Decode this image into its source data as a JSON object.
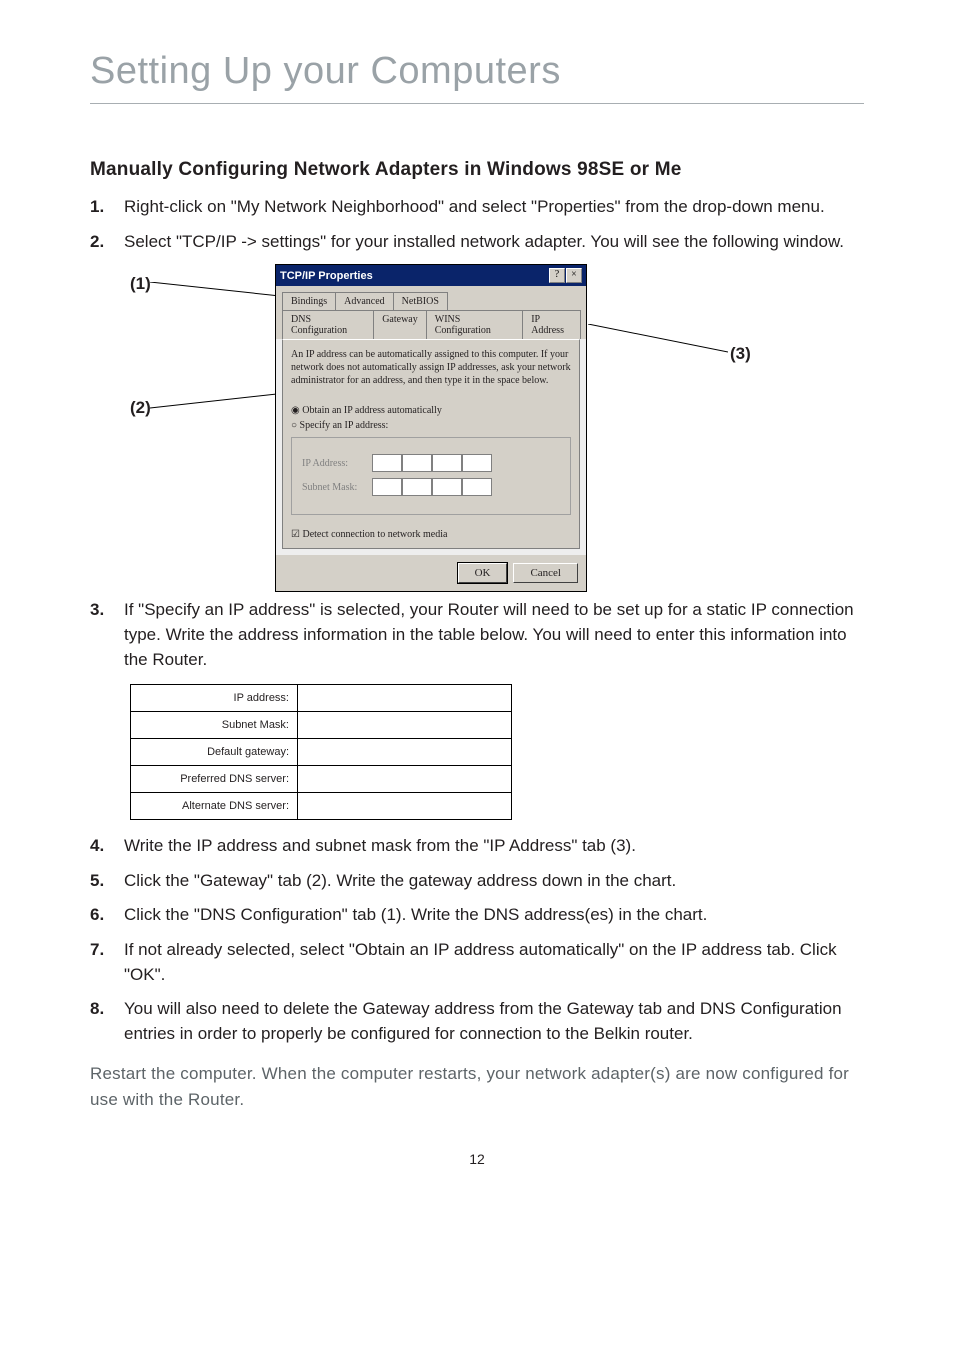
{
  "chapter_title": "Setting Up your Computers",
  "section_heading": "Manually Configuring Network Adapters in Windows 98SE or Me",
  "steps": {
    "s1": {
      "n": "1.",
      "t": "Right-click on \"My Network Neighborhood\" and select \"Properties\" from the drop-down menu."
    },
    "s2": {
      "n": "2.",
      "t": "Select \"TCP/IP -> settings\" for your installed network adapter. You will see the following window."
    },
    "s3": {
      "n": "3.",
      "t": "If \"Specify an IP address\" is selected, your Router will need to be set up for a static IP connection type. Write the address information in the table below. You will need to enter this information into the Router."
    },
    "s4": {
      "n": "4.",
      "t": "Write the IP address and subnet mask from the \"IP Address\" tab (3)."
    },
    "s5": {
      "n": "5.",
      "t": "Click the \"Gateway\" tab (2). Write the gateway address down in the chart."
    },
    "s6": {
      "n": "6.",
      "t": "Click the \"DNS Configuration\" tab (1). Write the DNS address(es) in the chart."
    },
    "s7": {
      "n": "7.",
      "t": "If not already selected, select \"Obtain an IP address automatically\" on the IP address tab. Click \"OK\"."
    },
    "s8": {
      "n": "8.",
      "t": "You will also need to delete the Gateway address from the Gateway tab and DNS Configuration entries in order to properly be configured for connection to the Belkin router."
    }
  },
  "callouts": {
    "c1": "(1)",
    "c2": "(2)",
    "c3": "(3)"
  },
  "win": {
    "title": "TCP/IP Properties",
    "help": "?",
    "close": "×",
    "tabs_row1": {
      "bindings": "Bindings",
      "advanced": "Advanced",
      "netbios": "NetBIOS"
    },
    "tabs_row2": {
      "dns": "DNS Configuration",
      "gateway": "Gateway",
      "wins": "WINS Configuration",
      "ip": "IP Address"
    },
    "desc": "An IP address can be automatically assigned to this computer. If your network does not automatically assign IP addresses, ask your network administrator for an address, and then type it in the space below.",
    "r_auto": "Obtain an IP address automatically",
    "r_spec": "Specify an IP address:",
    "ip_label": "IP Address:",
    "subnet_label": "Subnet Mask:",
    "detect": "Detect connection to network media",
    "ok": "OK",
    "cancel": "Cancel"
  },
  "table": {
    "ip": "IP address:",
    "subnet": "Subnet Mask:",
    "gateway": "Default gateway:",
    "pdns": "Preferred DNS server:",
    "adns": "Alternate DNS server:"
  },
  "restart": "Restart the computer. When the computer restarts, your network adapter(s) are now configured for use with the Router.",
  "page_number": "12"
}
